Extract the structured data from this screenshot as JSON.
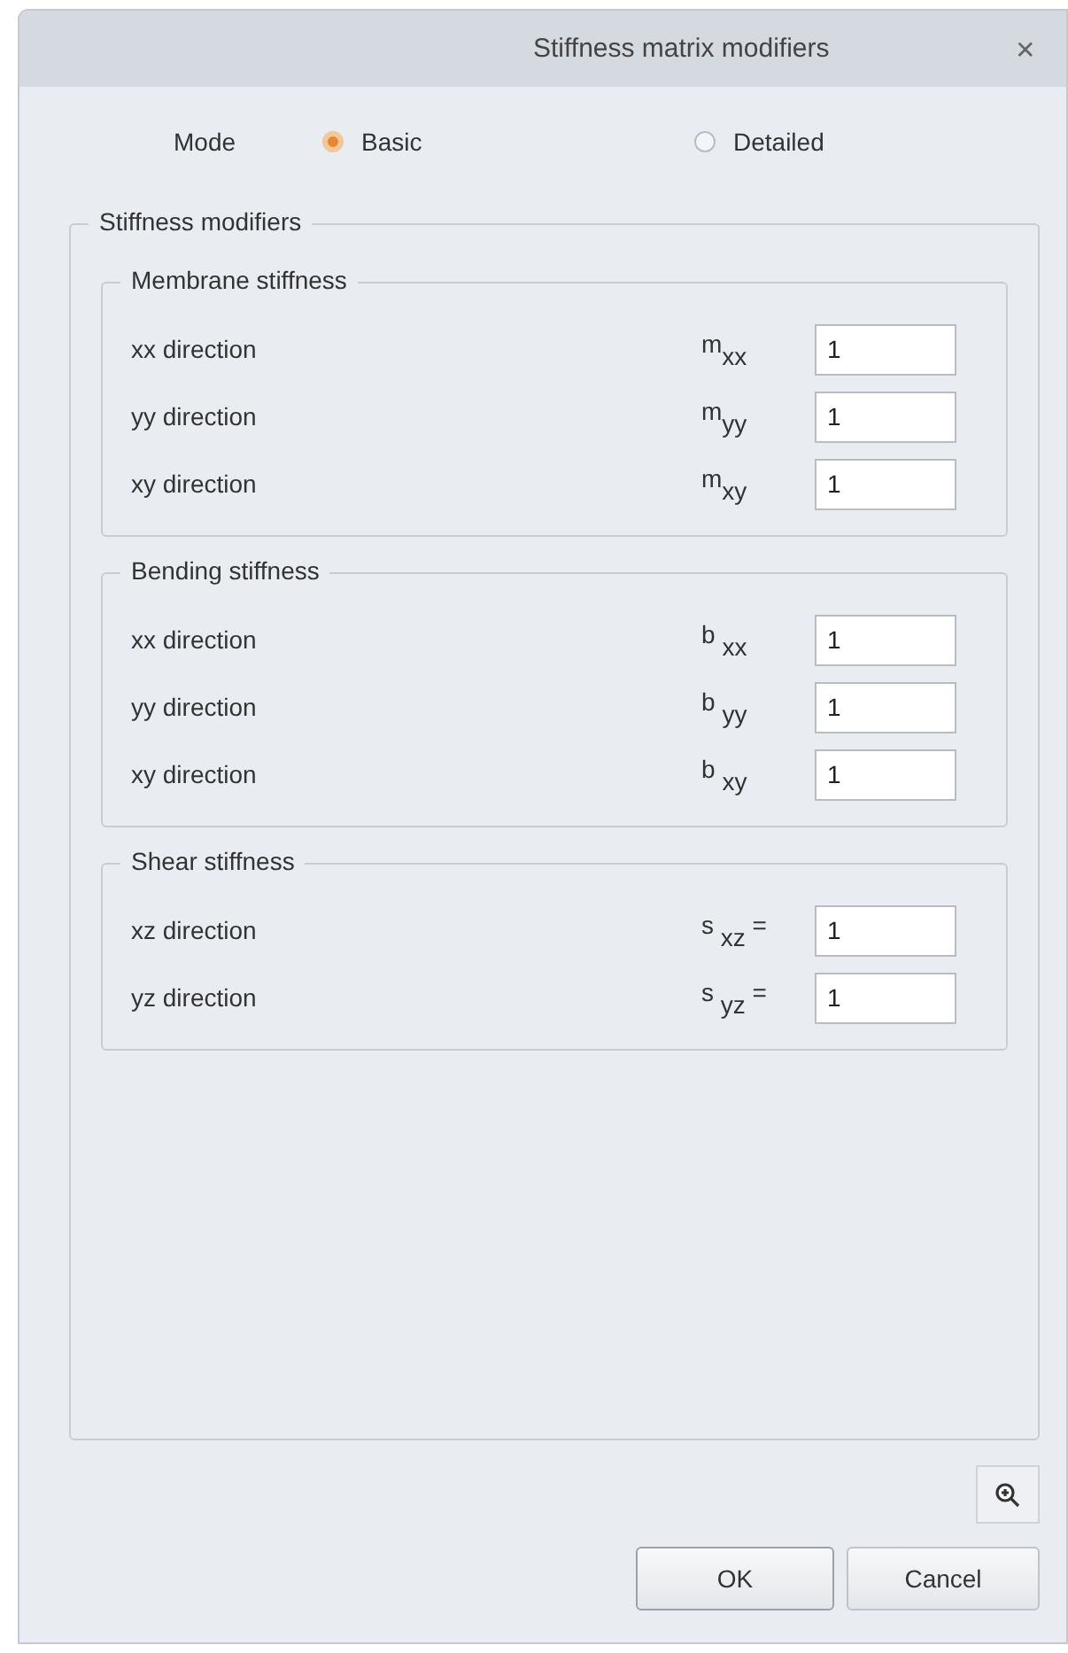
{
  "window": {
    "title": "Stiffness matrix modifiers",
    "close": "✕"
  },
  "mode": {
    "label": "Mode",
    "options": [
      {
        "label": "Basic",
        "selected": true
      },
      {
        "label": "Detailed",
        "selected": false
      }
    ]
  },
  "stiffness_modifiers": {
    "title": "Stiffness modifiers",
    "groups": [
      {
        "title": "Membrane stiffness",
        "rows": [
          {
            "label": "xx direction",
            "symbol": "m$_{xx}$",
            "value": "1"
          },
          {
            "label": "yy direction",
            "symbol": "m$_{yy}$",
            "value": "1"
          },
          {
            "label": "xy direction",
            "symbol": "m$_{xy}$",
            "value": "1"
          }
        ]
      },
      {
        "title": "Bending stiffness",
        "rows": [
          {
            "label": "xx direction",
            "symbol": "b $_{xx}$",
            "value": "1"
          },
          {
            "label": "yy direction",
            "symbol": "b $_{yy}$",
            "value": "1"
          },
          {
            "label": "xy direction",
            "symbol": "b $_{xy}$",
            "value": "1"
          }
        ]
      },
      {
        "title": "Shear stiffness",
        "rows": [
          {
            "label": "xz direction",
            "symbol": "s $_{xz}$ =",
            "value": "1"
          },
          {
            "label": "yz direction",
            "symbol": "s $_{yz}$ =",
            "value": "1"
          }
        ]
      }
    ]
  },
  "buttons": [
    "OK",
    "Cancel"
  ]
}
